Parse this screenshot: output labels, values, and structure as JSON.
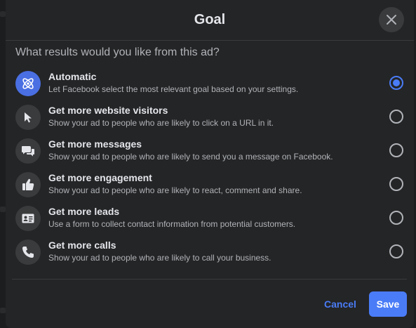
{
  "dialog": {
    "title": "Goal",
    "question": "What results would you like from this ad?"
  },
  "options": [
    {
      "icon": "atom-icon",
      "title": "Automatic",
      "description": "Let Facebook select the most relevant goal based on your settings.",
      "selected": true
    },
    {
      "icon": "cursor-icon",
      "title": "Get more website visitors",
      "description": "Show your ad to people who are likely to click on a URL in it.",
      "selected": false
    },
    {
      "icon": "chat-bubbles-icon",
      "title": "Get more messages",
      "description": "Show your ad to people who are likely to send you a message on Facebook.",
      "selected": false
    },
    {
      "icon": "thumbs-up-icon",
      "title": "Get more engagement",
      "description": "Show your ad to people who are likely to react, comment and share.",
      "selected": false
    },
    {
      "icon": "contact-card-icon",
      "title": "Get more leads",
      "description": "Use a form to collect contact information from potential customers.",
      "selected": false
    },
    {
      "icon": "phone-icon",
      "title": "Get more calls",
      "description": "Show your ad to people who are likely to call your business.",
      "selected": false
    }
  ],
  "footer": {
    "cancel_label": "Cancel",
    "save_label": "Save"
  },
  "colors": {
    "accent": "#4a7cf7",
    "modal_bg": "#242526",
    "icon_bg": "#3a3b3c",
    "text_primary": "#e4e6eb",
    "text_secondary": "#b0b3b8"
  }
}
